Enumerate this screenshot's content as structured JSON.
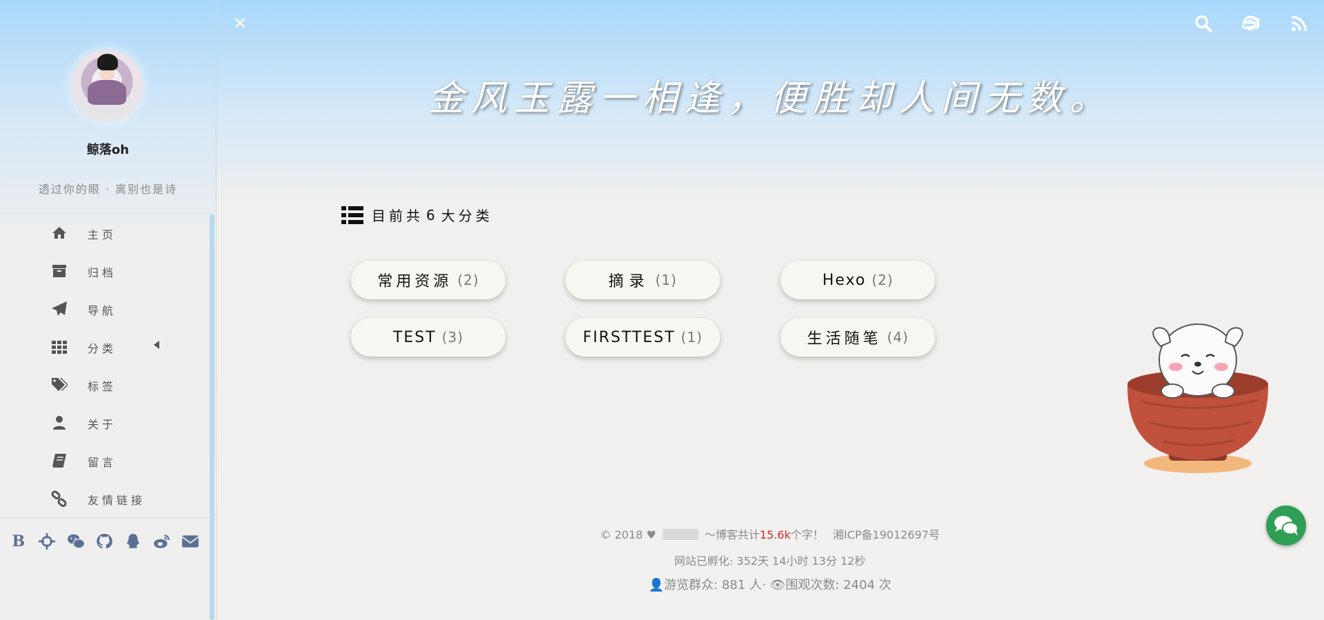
{
  "sidebar": {
    "username": "鲸落oh",
    "motto": "透过你的眼 · 离别也是诗",
    "menu": [
      {
        "label": "主页",
        "icon": "home-icon"
      },
      {
        "label": "归档",
        "icon": "archive-icon"
      },
      {
        "label": "导航",
        "icon": "paper-plane-icon"
      },
      {
        "label": "分类",
        "icon": "grid-icon",
        "has_submenu": true
      },
      {
        "label": "标签",
        "icon": "tags-icon"
      },
      {
        "label": "关于",
        "icon": "user-icon"
      },
      {
        "label": "留言",
        "icon": "book-icon"
      },
      {
        "label": "友情链接",
        "icon": "link-icon"
      }
    ],
    "social": [
      {
        "icon": "blogger-icon",
        "glyph": "B"
      },
      {
        "icon": "crosshair-icon"
      },
      {
        "icon": "wechat-icon"
      },
      {
        "icon": "github-icon"
      },
      {
        "icon": "qq-icon"
      },
      {
        "icon": "weibo-icon"
      },
      {
        "icon": "email-icon"
      }
    ]
  },
  "topbar": {
    "close_icon": "close-icon",
    "right_icons": [
      "search-icon",
      "browser-icon",
      "rss-icon"
    ]
  },
  "headline": "金风玉露一相逢，便胜却人间无数。",
  "categories_header": {
    "text_prefix": "目前共",
    "count": "6",
    "text_suffix": "大分类"
  },
  "categories": [
    {
      "name": "常用资源",
      "count": "(2)"
    },
    {
      "name": "摘录",
      "count": "(1)"
    },
    {
      "name": "Hexo",
      "count": "(2)"
    },
    {
      "name": "TEST",
      "count": "(3)"
    },
    {
      "name": "FIRSTTEST",
      "count": "(1)"
    },
    {
      "name": "生活随笔",
      "count": "(4)"
    }
  ],
  "footer": {
    "copyright": "2018",
    "word_count_prefix": "～博客共计",
    "word_count": "15.6k",
    "word_count_suffix": "个字！",
    "icp": "湘ICP备19012697号",
    "uptime_label": "网站已孵化:",
    "uptime": "352天 14小时 13分 12秒",
    "visitors_label": "游览群众:",
    "visitors": "881",
    "visitors_unit": "人",
    "views_label": "围观次数:",
    "views": "2404",
    "views_unit": "次"
  },
  "colors": {
    "accent_red": "#e0262c",
    "chat_green": "#2e9f55",
    "social_blue": "#5c6f94"
  }
}
